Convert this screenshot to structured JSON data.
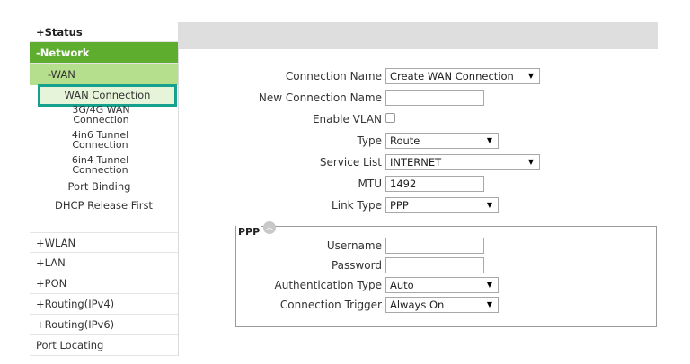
{
  "sidebar": {
    "status": "+Status",
    "network": "-Network",
    "wan": "-WAN",
    "wan_items": [
      "WAN Connection",
      "3G/4G WAN",
      "Connection",
      "4in6 Tunnel",
      "Connection",
      "6in4 Tunnel",
      "Connection",
      "Port Binding",
      "DHCP Release First"
    ],
    "items": [
      "+WLAN",
      "+LAN",
      "+PON",
      "+Routing(IPv4)",
      "+Routing(IPv6)",
      "Port Locating"
    ]
  },
  "form": {
    "connection_name": {
      "label": "Connection Name",
      "value": "Create WAN Connection"
    },
    "new_connection_name": {
      "label": "New Connection Name",
      "value": ""
    },
    "enable_vlan": {
      "label": "Enable VLAN",
      "checked": false
    },
    "type": {
      "label": "Type",
      "value": "Route"
    },
    "service_list": {
      "label": "Service List",
      "value": "INTERNET"
    },
    "mtu": {
      "label": "MTU",
      "value": "1492"
    },
    "link_type": {
      "label": "Link Type",
      "value": "PPP"
    }
  },
  "ppp": {
    "legend": "PPP",
    "username": {
      "label": "Username",
      "value": ""
    },
    "password": {
      "label": "Password",
      "value": ""
    },
    "auth_type": {
      "label": "Authentication Type",
      "value": "Auto"
    },
    "conn_trigger": {
      "label": "Connection Trigger",
      "value": "Always On"
    }
  },
  "icons": {
    "dropdown": "triangle-down-icon",
    "collapse": "chevron-up-icon"
  },
  "colors": {
    "network_bg": "#5fad2f",
    "wan_bg": "#b6df8d",
    "highlight_border": "#16a08e"
  }
}
